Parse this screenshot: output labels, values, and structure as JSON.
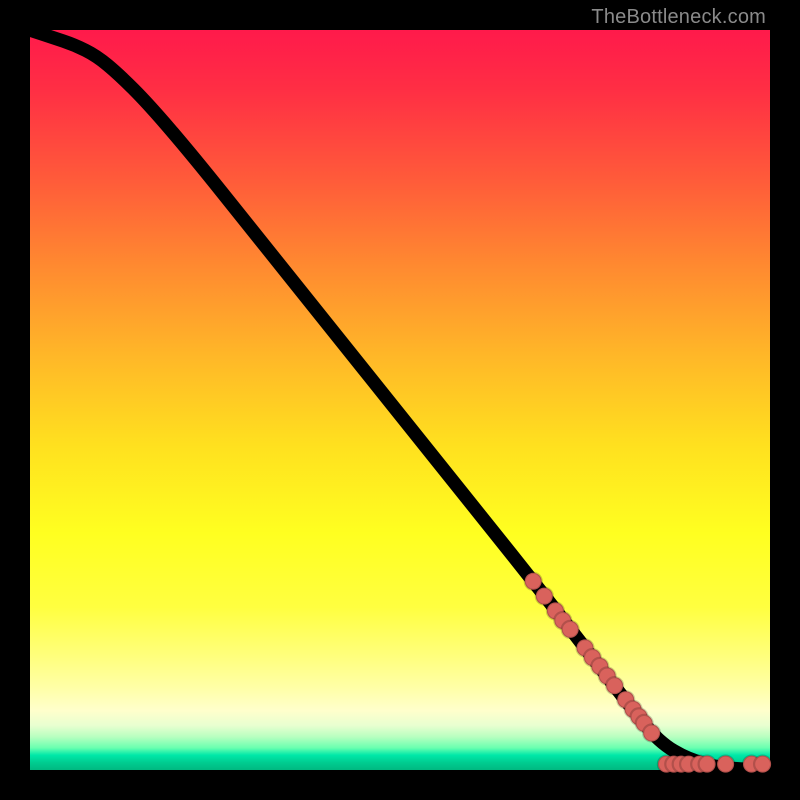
{
  "attribution": "TheBottleneck.com",
  "colors": {
    "marker": "#d9625c",
    "line": "#000000"
  },
  "chart_data": {
    "type": "line",
    "title": "",
    "xlabel": "",
    "ylabel": "",
    "xlim": [
      0,
      100
    ],
    "ylim": [
      0,
      100
    ],
    "grid": false,
    "legend": false,
    "series": [
      {
        "name": "bottleneck-curve",
        "x": [
          0,
          3,
          6,
          9,
          12,
          16,
          22,
          30,
          40,
          50,
          60,
          70,
          80,
          84,
          86,
          88,
          90,
          92,
          94,
          96,
          98,
          100
        ],
        "y": [
          100,
          99,
          98,
          96.5,
          94,
          90,
          83,
          73,
          60.5,
          48,
          35.5,
          23,
          10,
          5,
          3.2,
          2,
          1.2,
          0.6,
          0.3,
          0.15,
          0.05,
          0
        ]
      }
    ],
    "markers": [
      {
        "x": 68,
        "y": 25.5
      },
      {
        "x": 69.5,
        "y": 23.5
      },
      {
        "x": 71,
        "y": 21.5
      },
      {
        "x": 72,
        "y": 20.2
      },
      {
        "x": 73,
        "y": 19
      },
      {
        "x": 75,
        "y": 16.5
      },
      {
        "x": 76,
        "y": 15.2
      },
      {
        "x": 77,
        "y": 14
      },
      {
        "x": 78,
        "y": 12.7
      },
      {
        "x": 79,
        "y": 11.4
      },
      {
        "x": 80.5,
        "y": 9.5
      },
      {
        "x": 81.5,
        "y": 8.2
      },
      {
        "x": 82.3,
        "y": 7.2
      },
      {
        "x": 83,
        "y": 6.3
      },
      {
        "x": 84,
        "y": 5
      },
      {
        "x": 86,
        "y": 0.8
      },
      {
        "x": 87,
        "y": 0.8
      },
      {
        "x": 88,
        "y": 0.8
      },
      {
        "x": 89,
        "y": 0.8
      },
      {
        "x": 90.5,
        "y": 0.8
      },
      {
        "x": 91.5,
        "y": 0.8
      },
      {
        "x": 94,
        "y": 0.8
      },
      {
        "x": 97.5,
        "y": 0.8
      },
      {
        "x": 99,
        "y": 0.8
      }
    ]
  }
}
